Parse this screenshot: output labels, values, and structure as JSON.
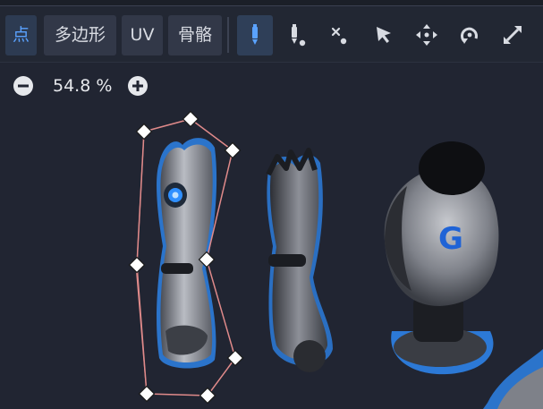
{
  "tabs": [
    {
      "label": "点",
      "active": true
    },
    {
      "label": "多边形",
      "active": false
    },
    {
      "label": "UV",
      "active": false
    },
    {
      "label": "骨骼",
      "active": false
    }
  ],
  "tools": [
    {
      "name": "pen-icon",
      "active": true
    },
    {
      "name": "add-point-pen-icon",
      "active": false
    },
    {
      "name": "remove-point-icon",
      "active": false
    },
    {
      "name": "select-arrow-icon",
      "active": false
    },
    {
      "name": "move-icon",
      "active": false
    },
    {
      "name": "rotate-icon",
      "active": false
    },
    {
      "name": "scale-icon",
      "active": false
    }
  ],
  "zoom": {
    "value": "54.8 %",
    "zoom_out_icon": "minus-circle-icon",
    "zoom_in_icon": "plus-circle-icon"
  },
  "canvas": {
    "sprite_letter": "G",
    "polygon_color": "#e08a8a",
    "accent": "#5aa2ff",
    "glow": "#2f8fff"
  }
}
